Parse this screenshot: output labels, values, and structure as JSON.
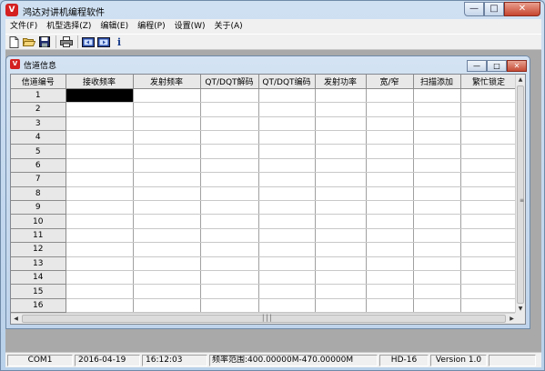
{
  "window": {
    "title": "鸿达对讲机编程软件",
    "icon": "V"
  },
  "menu": [
    "文件(F)",
    "机型选择(Z)",
    "编辑(E)",
    "编程(P)",
    "设置(W)",
    "关于(A)"
  ],
  "toolbar": [
    {
      "icon": "new-file-icon"
    },
    {
      "icon": "open-folder-icon"
    },
    {
      "icon": "save-disk-icon"
    },
    {
      "icon": "print-icon"
    },
    {
      "icon": "read-radio-icon"
    },
    {
      "icon": "write-radio-icon"
    },
    {
      "icon": "info-icon",
      "glyph": "i"
    }
  ],
  "child": {
    "title": "信道信息",
    "columns": [
      "信道编号",
      "接收频率",
      "发射频率",
      "QT/DQT解码",
      "QT/DQT编码",
      "发射功率",
      "宽/窄",
      "扫描添加",
      "繁忙锁定"
    ],
    "rows": [
      "1",
      "2",
      "3",
      "4",
      "5",
      "6",
      "7",
      "8",
      "9",
      "10",
      "11",
      "12",
      "13",
      "14",
      "15",
      "16"
    ]
  },
  "status": {
    "port": "COM1",
    "date": "2016-04-19",
    "time": "16:12:03",
    "freq_range": "频率范围:400.00000M-470.00000M",
    "model": "HD-16",
    "version": "Version 1.0"
  },
  "colors": {
    "accent": "#d42020",
    "selected_cell": "#000000"
  }
}
